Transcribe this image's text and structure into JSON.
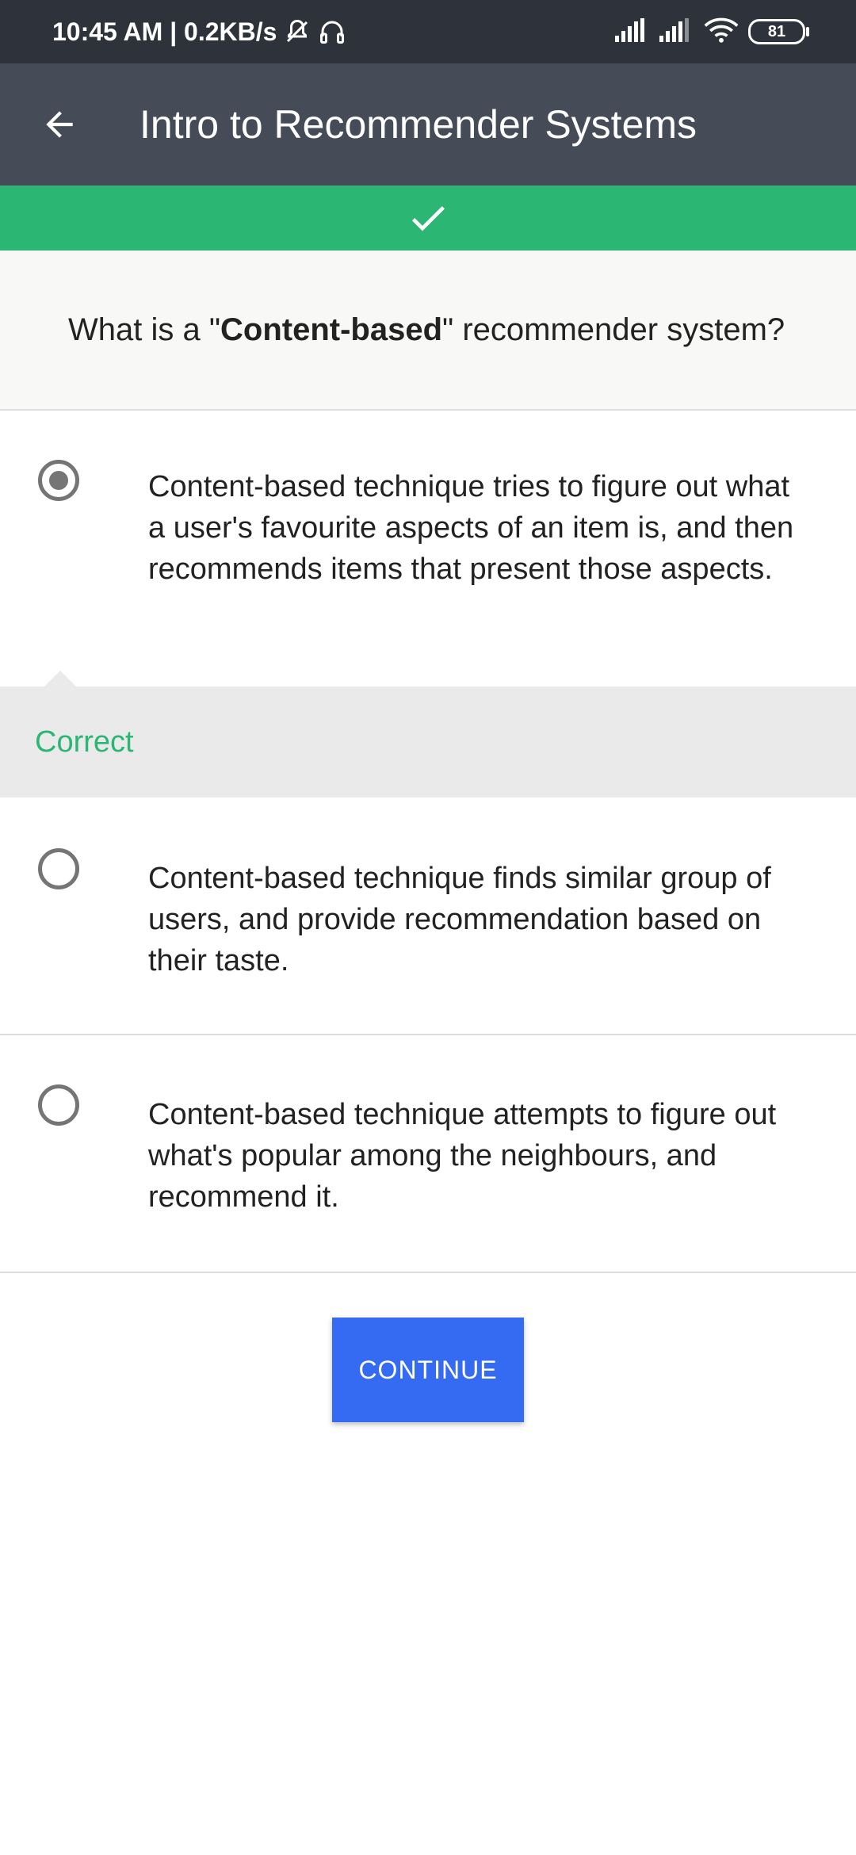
{
  "status_bar": {
    "time": "10:45 AM",
    "network_speed": "0.2KB/s",
    "battery": "81",
    "icons": [
      "do-not-disturb-icon",
      "headphones-icon",
      "signal-icon",
      "signal-icon",
      "wifi-icon",
      "battery-icon"
    ]
  },
  "app_bar": {
    "title": "Intro to Recommender Systems",
    "back_icon": "arrow-back-icon"
  },
  "result_banner": {
    "icon": "check-icon",
    "color": "#2bb673"
  },
  "question": {
    "prefix": "What is a \"",
    "emphasis": "Content-based",
    "suffix": "\" recommender system?"
  },
  "options": [
    {
      "text": "Content-based technique tries to figure out what a user's favourite aspects of an item is, and then recommends items that present those aspects.",
      "selected": true
    },
    {
      "text": "Content-based technique finds similar group of users, and provide recommendation based on their taste.",
      "selected": false
    },
    {
      "text": "Content-based technique attempts to figure out what's popular among the neighbours, and recommend it.",
      "selected": false
    }
  ],
  "feedback": {
    "label": "Correct"
  },
  "actions": {
    "continue_label": "CONTINUE"
  },
  "colors": {
    "app_bar": "#454c57",
    "status_bar": "#2e323a",
    "success": "#2bb673",
    "primary_button": "#356bf2"
  }
}
